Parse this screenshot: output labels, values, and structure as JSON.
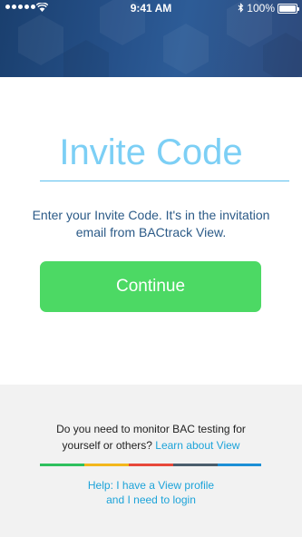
{
  "status_bar": {
    "time": "9:41 AM",
    "battery_percent": "100%"
  },
  "header": {
    "background_color": "#26518a"
  },
  "title": "Invite Code",
  "description": {
    "line1": "Enter your Invite Code. It's in the invitation",
    "line2": "email from BACtrack View."
  },
  "continue_button": {
    "label": "Continue",
    "color": "#4cd964"
  },
  "footer": {
    "question_line1": "Do you need to monitor BAC testing for",
    "question_line2": "yourself or others?",
    "learn_link": "Learn about View",
    "help_line1": "Help: I have a View profile",
    "help_line2": "and I need to login",
    "bar_colors": [
      "#2ec05e",
      "#f3b71c",
      "#e8483b",
      "#4b5e6d",
      "#1c8fd6"
    ]
  }
}
